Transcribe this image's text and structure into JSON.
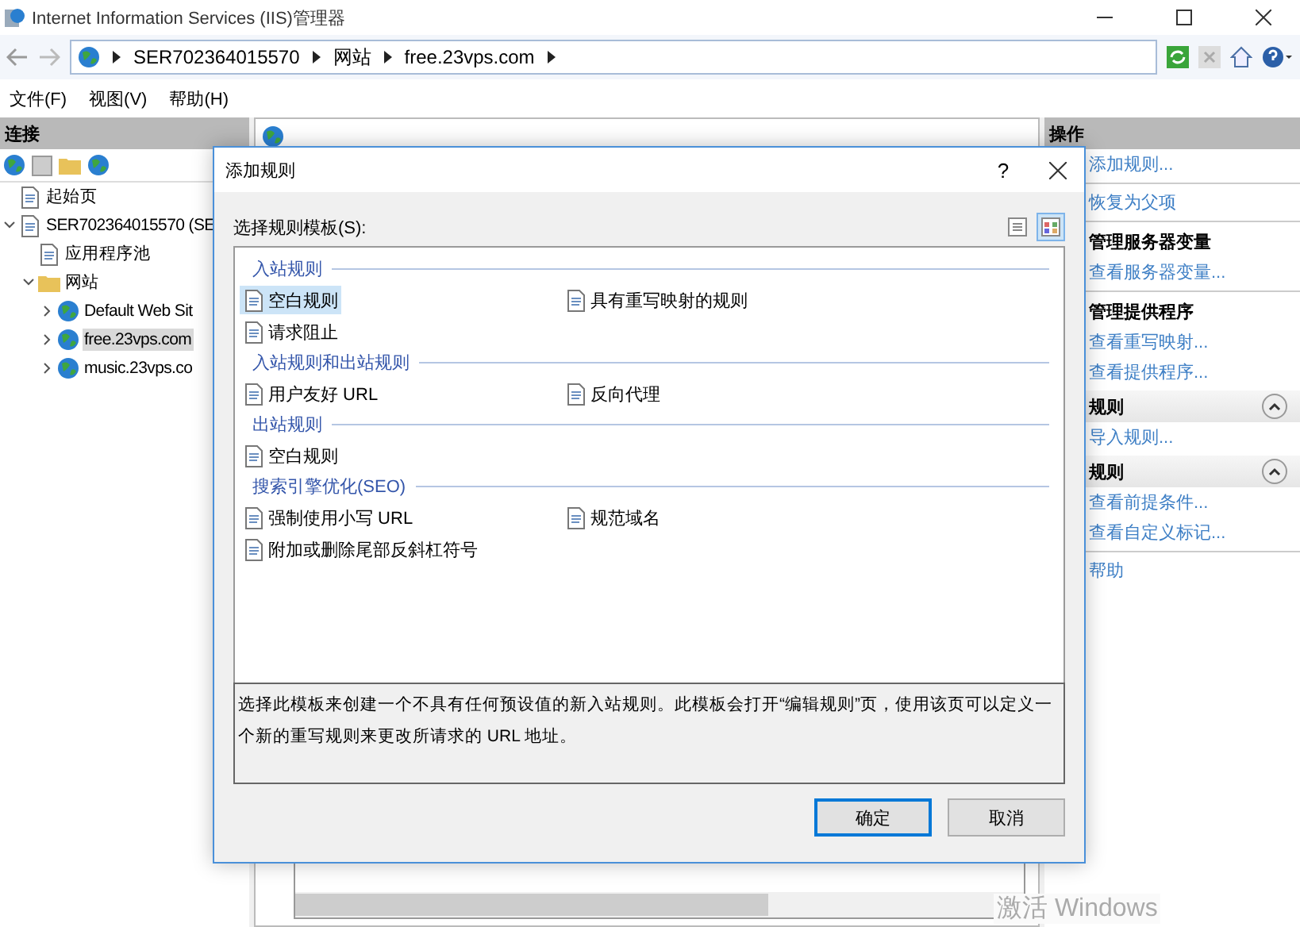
{
  "window": {
    "title": "Internet Information Services (IIS)管理器"
  },
  "address": {
    "crumbs": [
      "SER702364015570",
      "网站",
      "free.23vps.com"
    ]
  },
  "menu": [
    "文件(F)",
    "视图(V)",
    "帮助(H)"
  ],
  "connections": {
    "title": "连接",
    "tree": [
      {
        "label": "起始页",
        "selected": false
      },
      {
        "label": "SER702364015570 (SE",
        "selected": false,
        "expanded": true,
        "children": [
          {
            "label": "应用程序池",
            "selected": false
          },
          {
            "label": "网站",
            "selected": false,
            "expanded": true,
            "children": [
              {
                "label": "Default Web Sit",
                "selected": false,
                "expanded": false
              },
              {
                "label": "free.23vps.com",
                "selected": true,
                "expanded": false
              },
              {
                "label": "music.23vps.co",
                "selected": false,
                "expanded": false
              }
            ]
          }
        ]
      }
    ]
  },
  "actions": {
    "title": "操作",
    "items": [
      {
        "kind": "link",
        "label": "添加规则..."
      },
      {
        "kind": "divider"
      },
      {
        "kind": "link",
        "label": "恢复为父项"
      },
      {
        "kind": "divider"
      },
      {
        "kind": "heading",
        "label": "管理服务器变量"
      },
      {
        "kind": "link",
        "label": "查看服务器变量..."
      },
      {
        "kind": "divider"
      },
      {
        "kind": "heading",
        "label": "管理提供程序"
      },
      {
        "kind": "link",
        "label": "查看重写映射..."
      },
      {
        "kind": "link",
        "label": "查看提供程序..."
      },
      {
        "kind": "section",
        "label": "规则",
        "expanded": true
      },
      {
        "kind": "link",
        "label": "导入规则..."
      },
      {
        "kind": "section",
        "label": "规则",
        "expanded": true
      },
      {
        "kind": "link",
        "label": "查看前提条件..."
      },
      {
        "kind": "link",
        "label": "查看自定义标记..."
      },
      {
        "kind": "divider"
      },
      {
        "kind": "link",
        "label": "帮助"
      }
    ]
  },
  "dialog": {
    "title": "添加规则",
    "help": "?",
    "label": "选择规则模板(S):",
    "view_modes": [
      {
        "selected": false
      },
      {
        "selected": true
      }
    ],
    "groups": [
      {
        "title": "入站规则",
        "templates": [
          {
            "label": "空白规则",
            "selected": true
          },
          {
            "label": "具有重写映射的规则",
            "selected": false
          },
          {
            "label": "请求阻止",
            "selected": false
          }
        ]
      },
      {
        "title": "入站规则和出站规则",
        "templates": [
          {
            "label": "用户友好 URL",
            "selected": false
          },
          {
            "label": "反向代理",
            "selected": false
          }
        ]
      },
      {
        "title": "出站规则",
        "templates": [
          {
            "label": "空白规则",
            "selected": false
          }
        ]
      },
      {
        "title": "搜索引擎优化(SEO)",
        "templates": [
          {
            "label": "强制使用小写 URL",
            "selected": false
          },
          {
            "label": "规范域名",
            "selected": false
          },
          {
            "label": "附加或删除尾部反斜杠符号",
            "selected": false
          }
        ]
      }
    ],
    "description": "选择此模板来创建一个不具有任何预设值的新入站规则。此模板会打开“编辑规则”页，使用该页可以定义一个新的重写规则来更改所请求的 URL 地址。",
    "buttons": [
      {
        "label": "确定",
        "default": true
      },
      {
        "label": "取消",
        "default": false
      }
    ]
  },
  "activation_notice": "激活 Windows"
}
